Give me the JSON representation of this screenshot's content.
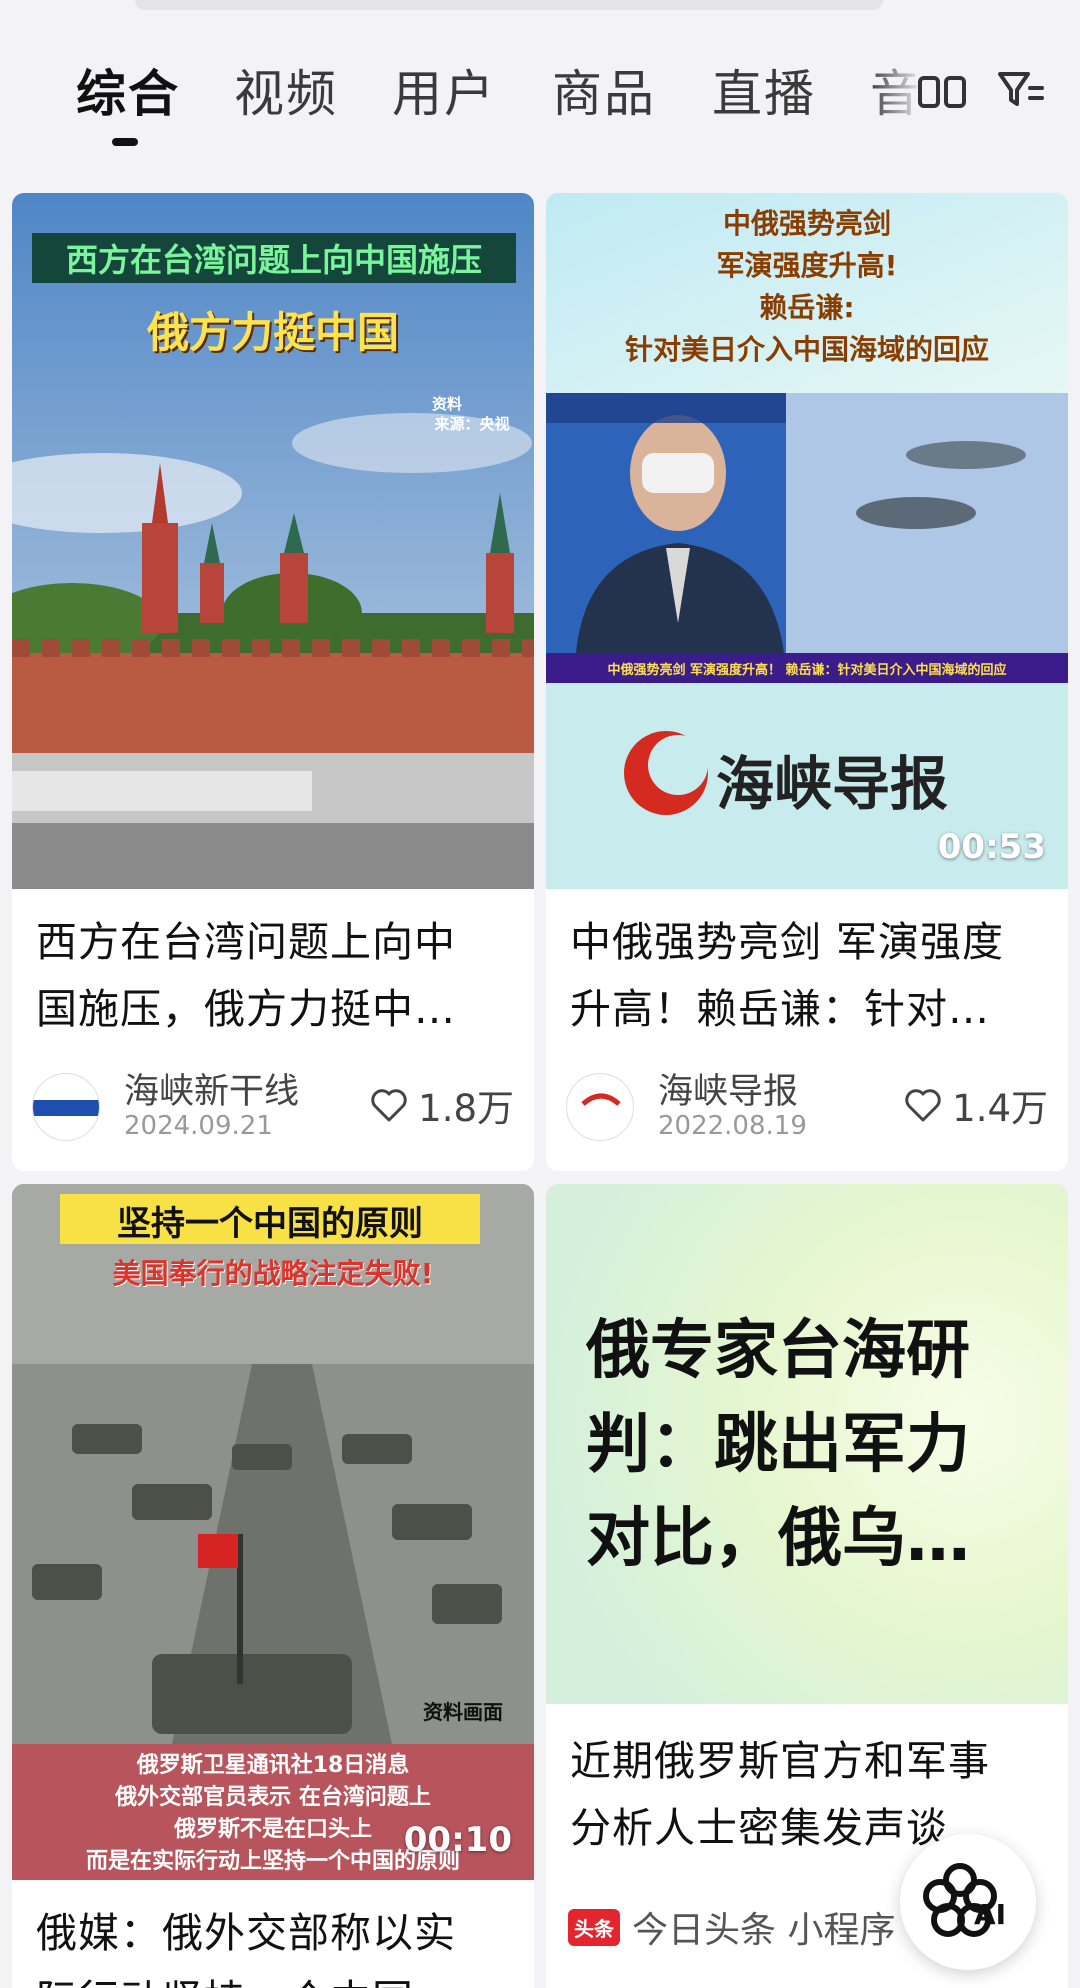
{
  "tabs": [
    {
      "label": "综合",
      "active": true
    },
    {
      "label": "视频"
    },
    {
      "label": "用户"
    },
    {
      "label": "商品"
    },
    {
      "label": "直播"
    },
    {
      "label": "音"
    }
  ],
  "icons": {
    "layout_toggle": "grid-icon",
    "filter": "filter-icon"
  },
  "cards": [
    {
      "overlay_banner": "西方在台湾问题上向中国施压",
      "overlay_headline": "俄方力挺中国",
      "overlay_source_line1": "资料",
      "overlay_source_line2": "来源：央视",
      "title_line1": "西方在台湾问题上向中",
      "title_line2": "国施压，俄方力挺中…",
      "author": "海峡新干线",
      "date": "2024.09.21",
      "likes": "1.8万"
    },
    {
      "overlay_lines": [
        "中俄强势亮剑",
        "军演强度升高!",
        "赖岳谦:",
        "针对美日介入中国海域的回应"
      ],
      "ticker": "中俄强势亮剑 军演强度升高！ 赖岳谦：针对美日介入中国海域的回应",
      "logo_text": "海峡导报",
      "duration": "00:53",
      "title_line1": "中俄强势亮剑 军演强度",
      "title_line2": "升高！赖岳谦：针对…",
      "author": "海峡导报",
      "date": "2022.08.19",
      "likes": "1.4万"
    },
    {
      "overlay_banner": "坚持一个中国的原则",
      "overlay_sub": "美国奉行的战略注定失败!",
      "overlay_source": "资料画面",
      "caption_lines": [
        "俄罗斯卫星通讯社18日消息",
        "俄外交部官员表示 在台湾问题上",
        "俄罗斯不是在口头上",
        "而是在实际行动上坚持一个中国的原则"
      ],
      "duration": "00:10",
      "title_line1": "俄媒：俄外交部称以实",
      "title_line2": "际行动坚持一个中国…"
    },
    {
      "big_text_lines": [
        "俄专家台海研",
        "判：跳出军力",
        "对比，俄乌…"
      ],
      "title_line1": "近期俄罗斯官方和军事",
      "title_line2": "分析人士密集发声谈…",
      "source_badge": "头条",
      "source_name": "今日头条 小程序"
    }
  ],
  "ai_button": {
    "label": "AI"
  },
  "colors": {
    "background": "#f3f3f5",
    "card": "#ffffff",
    "text": "#111111",
    "muted": "#999999"
  }
}
